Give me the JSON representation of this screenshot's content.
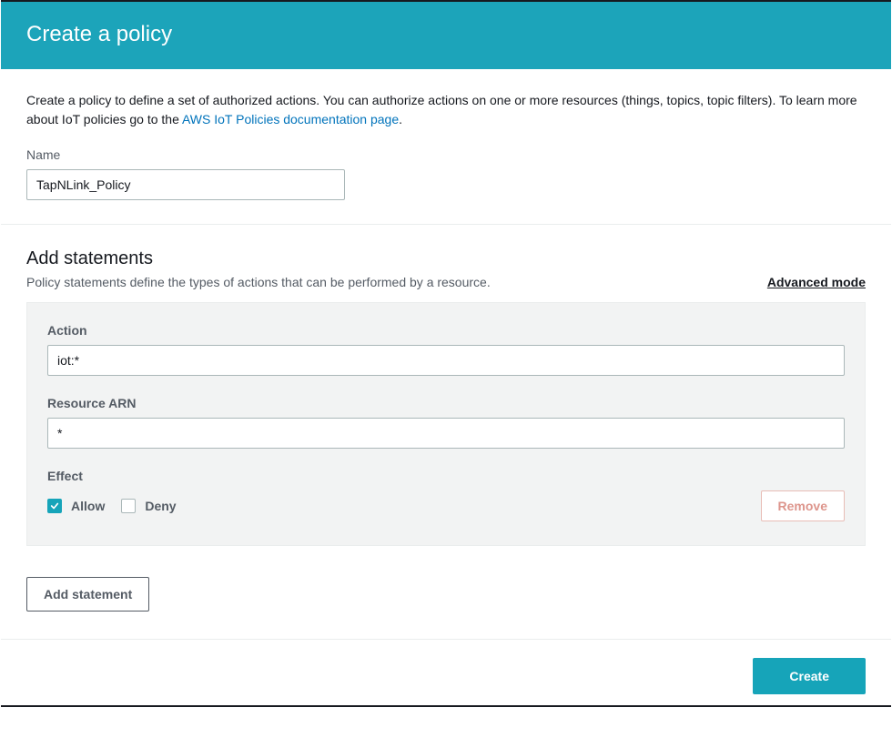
{
  "header": {
    "title": "Create a policy"
  },
  "description": {
    "text_before": "Create a policy to define a set of authorized actions. You can authorize actions on one or more resources (things, topics, topic filters). To learn more about IoT policies go to the ",
    "link_text": "AWS IoT Policies documentation page",
    "text_after": "."
  },
  "name": {
    "label": "Name",
    "value": "TapNLink_Policy"
  },
  "statements": {
    "heading": "Add statements",
    "subtext": "Policy statements define the types of actions that can be performed by a resource.",
    "advanced_label": "Advanced mode",
    "action": {
      "label": "Action",
      "value": "iot:*"
    },
    "resource": {
      "label": "Resource ARN",
      "value": "*"
    },
    "effect": {
      "label": "Effect",
      "allow_label": "Allow",
      "deny_label": "Deny",
      "allow_checked": true,
      "deny_checked": false
    },
    "remove_label": "Remove",
    "add_label": "Add statement"
  },
  "footer": {
    "create_label": "Create"
  }
}
